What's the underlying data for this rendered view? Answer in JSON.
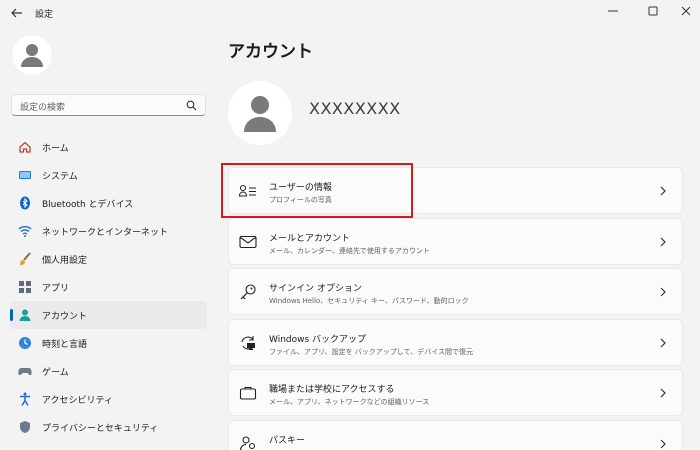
{
  "window": {
    "title": "設定",
    "controls": [
      "minimize",
      "maximize",
      "close"
    ]
  },
  "sidebar": {
    "search_placeholder": "設定の検索",
    "items": [
      {
        "label": "ホーム",
        "icon": "home-icon"
      },
      {
        "label": "システム",
        "icon": "system-icon"
      },
      {
        "label": "Bluetooth とデバイス",
        "icon": "bluetooth-icon"
      },
      {
        "label": "ネットワークとインターネット",
        "icon": "wifi-icon"
      },
      {
        "label": "個人用設定",
        "icon": "brush-icon"
      },
      {
        "label": "アプリ",
        "icon": "apps-icon"
      },
      {
        "label": "アカウント",
        "icon": "account-icon",
        "selected": true
      },
      {
        "label": "時刻と言語",
        "icon": "time-language-icon"
      },
      {
        "label": "ゲーム",
        "icon": "gamepad-icon"
      },
      {
        "label": "アクセシビリティ",
        "icon": "accessibility-icon"
      },
      {
        "label": "プライバシーとセキュリティ",
        "icon": "shield-icon"
      }
    ]
  },
  "main": {
    "title": "アカウント",
    "username": "XXXXXXXX",
    "cards": [
      {
        "title": "ユーザーの情報",
        "subtitle": "プロフィールの写真",
        "icon": "user-info-icon",
        "highlighted": true
      },
      {
        "title": "メールとアカウント",
        "subtitle": "メール、カレンダー、連絡先で使用するアカウント",
        "icon": "mail-icon"
      },
      {
        "title": "サインイン オプション",
        "subtitle": "Windows Hello、セキュリティ キー、パスワード、動的ロック",
        "icon": "key-icon"
      },
      {
        "title": "Windows バックアップ",
        "subtitle": "ファイル、アプリ、設定を バックアップして、デバイス間で復元",
        "icon": "backup-icon"
      },
      {
        "title": "職場または学校にアクセスする",
        "subtitle": "メール、アプリ、ネットワークなどの組織リソース",
        "icon": "briefcase-icon"
      },
      {
        "title": "パスキー",
        "subtitle": "",
        "icon": "passkey-icon"
      }
    ]
  },
  "colors": {
    "accent": "#0067c0",
    "highlight_box": "#d71a1a",
    "background": "#f3f3f3",
    "card": "#fbfbfb"
  }
}
